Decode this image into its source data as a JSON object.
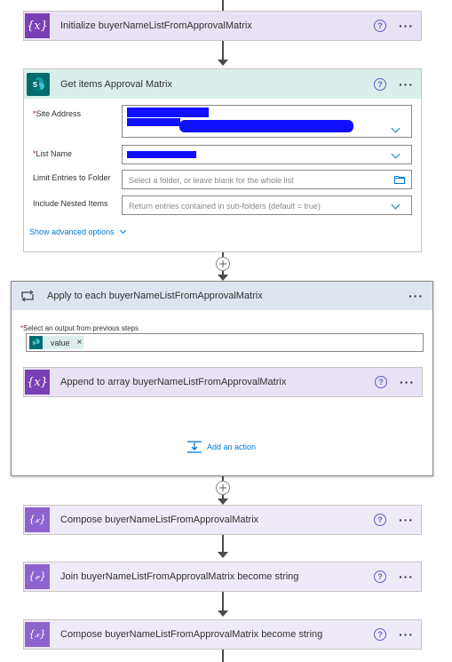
{
  "steps": {
    "init": {
      "title": "Initialize buyerNameListFromApprovalMatrix",
      "icon": "variable-icon"
    },
    "get_items": {
      "title": "Get items Approval Matrix",
      "icon": "sharepoint-icon",
      "fields": {
        "site_address": {
          "label": "Site Address",
          "required": "*"
        },
        "list_name": {
          "label": "List Name",
          "required": "*"
        },
        "limit_folder": {
          "label": "Limit Entries to Folder",
          "placeholder": "Select a folder, or leave blank for the whole list"
        },
        "nested": {
          "label": "Include Nested Items",
          "placeholder": "Return entries contained in sub-folders (default = true)"
        }
      },
      "advanced_link": "Show advanced options"
    },
    "apply_each": {
      "title": "Apply to each buyerNameListFromApprovalMatrix",
      "icon": "loop-icon",
      "select_label": "Select an output from previous steps",
      "required": "*",
      "token": "value",
      "inner": {
        "title": "Append to array buyerNameListFromApprovalMatrix",
        "icon": "variable-icon"
      },
      "add_action": "Add an action"
    },
    "compose1": {
      "title": "Compose buyerNameListFromApprovalMatrix",
      "icon": "compose-icon"
    },
    "join": {
      "title": "Join buyerNameListFromApprovalMatrix become string",
      "icon": "join-icon"
    },
    "compose2": {
      "title": "Compose buyerNameListFromApprovalMatrix become string",
      "icon": "compose-icon"
    }
  },
  "common": {
    "help": "?",
    "more": "···",
    "icon_x": "{x}",
    "icon_compose": "{𝓍}",
    "icon_join": "{𝓋}",
    "token_remove": "×"
  },
  "colors": {
    "variable": "#7b3fb5",
    "sharepoint_header": "#dceeec",
    "loop_header": "#dfe5ef",
    "link": "#0078d4"
  }
}
